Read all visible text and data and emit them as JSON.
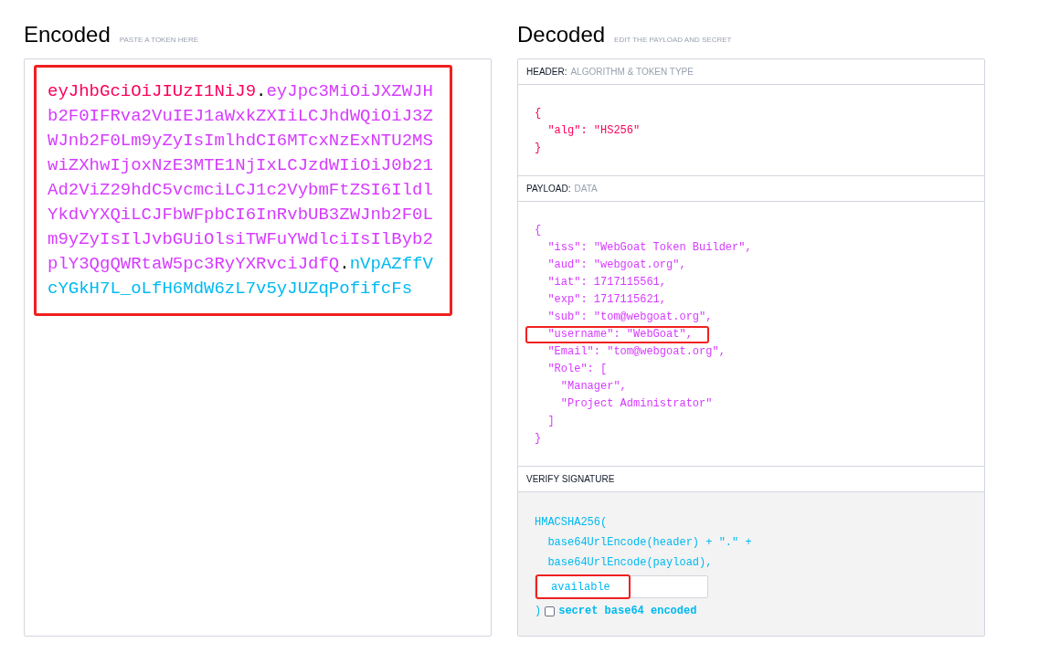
{
  "encoded": {
    "title": "Encoded",
    "subtitle": "PASTE A TOKEN HERE",
    "token": {
      "highlighted": true,
      "segments": [
        {
          "kind": "header",
          "text": "eyJhbGciOiJIUzI1NiJ9"
        },
        {
          "kind": "dot",
          "text": "."
        },
        {
          "kind": "payload",
          "text": "eyJpc3MiOiJXZWJHb2F0IFRva2VuIEJ1aWxkZXIiLCJhdWQiOiJ3ZWJnb2F0Lm9yZyIsImlhdCI6MTcxNzExNTU2MSwiZXhwIjoxNzE3MTE1NjIxLCJzdWIiOiJ0b21Ad2ViZ29hdC5vcmciLCJ1c2VybmFtZSI6IldlYkdvYXQiLCJFbWFpbCI6InRvbUB3ZWJnb2F0Lm9yZyIsIlJvbGUiOlsiTWFuYWdlciIsIlByb2plY3QgQWRtaW5pc3RyYXRvciJdfQ"
        },
        {
          "kind": "dot",
          "text": "."
        },
        {
          "kind": "signature",
          "text": "nVpAZffVcYGkH7L_oLfH6MdW6zL7v5yJUZqPofifcFs"
        }
      ]
    }
  },
  "decoded": {
    "title": "Decoded",
    "subtitle": "EDIT THE PAYLOAD AND SECRET",
    "header": {
      "label": "HEADER:",
      "sublabel": "ALGORITHM & TOKEN TYPE",
      "lines": [
        {
          "text": "{",
          "highlighted": false
        },
        {
          "text": "  \"alg\": \"HS256\"",
          "highlighted": false
        },
        {
          "text": "}",
          "highlighted": false
        }
      ]
    },
    "payload": {
      "label": "PAYLOAD:",
      "sublabel": "DATA",
      "lines": [
        {
          "text": "{",
          "highlighted": false
        },
        {
          "text": "  \"iss\": \"WebGoat Token Builder\",",
          "highlighted": false
        },
        {
          "text": "  \"aud\": \"webgoat.org\",",
          "highlighted": false
        },
        {
          "text": "  \"iat\": 1717115561,",
          "highlighted": false
        },
        {
          "text": "  \"exp\": 1717115621,",
          "highlighted": false
        },
        {
          "text": "  \"sub\": \"tom@webgoat.org\",",
          "highlighted": false
        },
        {
          "text": "  \"username\": \"WebGoat\",",
          "highlighted": true
        },
        {
          "text": "  \"Email\": \"tom@webgoat.org\",",
          "highlighted": false
        },
        {
          "text": "  \"Role\": [",
          "highlighted": false
        },
        {
          "text": "    \"Manager\",",
          "highlighted": false
        },
        {
          "text": "    \"Project Administrator\"",
          "highlighted": false
        },
        {
          "text": "  ]",
          "highlighted": false
        },
        {
          "text": "}",
          "highlighted": false
        }
      ]
    },
    "verify": {
      "label": "VERIFY SIGNATURE",
      "lines": [
        {
          "text": "HMACSHA256("
        },
        {
          "text": "  base64UrlEncode(header) + \".\" +"
        },
        {
          "text": "  base64UrlEncode(payload),"
        }
      ],
      "secret": {
        "value": "available",
        "highlighted": true
      },
      "closing": ")",
      "base64_encoded": {
        "label": "secret base64 encoded",
        "checked": false
      }
    }
  }
}
